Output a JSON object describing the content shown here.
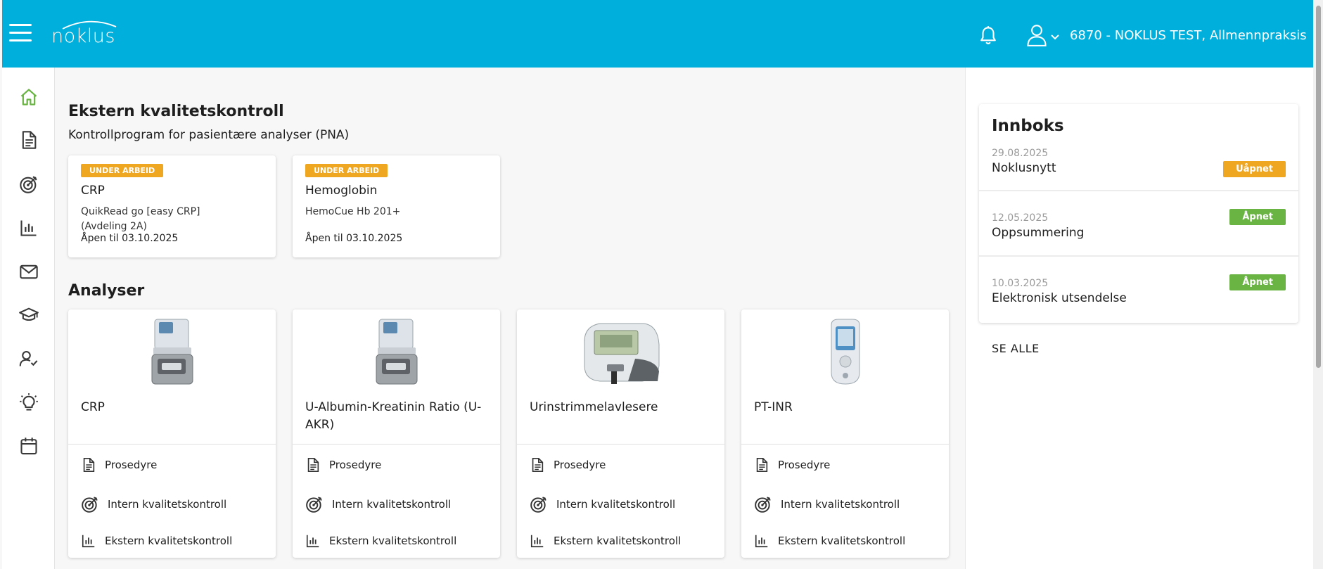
{
  "header": {
    "logo_text": "noklus",
    "user_label": "6870 - NOKLUS TEST, Allmennpraksis",
    "colors": {
      "brand": "#00afdc",
      "home_active": "#6ab444"
    }
  },
  "sidebar": {
    "items": [
      {
        "icon": "home-icon",
        "active": true
      },
      {
        "icon": "document-icon"
      },
      {
        "icon": "target-icon"
      },
      {
        "icon": "bar-chart-icon"
      },
      {
        "icon": "mail-icon"
      },
      {
        "icon": "graduation-cap-icon"
      },
      {
        "icon": "user-check-icon"
      },
      {
        "icon": "lightbulb-icon"
      },
      {
        "icon": "calendar-icon"
      }
    ]
  },
  "eqa": {
    "title": "Ekstern kvalitetskontroll",
    "subtitle": "Kontrollprogram for pasientære analyser (PNA)",
    "cards": [
      {
        "status": "UNDER ARBEID",
        "title": "CRP",
        "device": "QuikRead go [easy CRP] (Avdeling 2A)",
        "open_until": "Åpen til 03.10.2025"
      },
      {
        "status": "UNDER ARBEID",
        "title": "Hemoglobin",
        "device": "HemoCue Hb 201+",
        "open_until": "Åpen til 03.10.2025"
      }
    ]
  },
  "analyses": {
    "title": "Analyser",
    "link_labels": {
      "procedure": "Prosedyre",
      "internal": "Intern kvalitetskontroll",
      "external": "Ekstern kvalitetskontroll"
    },
    "cards": [
      {
        "title": "CRP",
        "image": "analyzer-device-image"
      },
      {
        "title": "U-Albumin-Kreatinin Ratio (U-AKR)",
        "image": "analyzer-device-image"
      },
      {
        "title": "Urinstrimmelavlesere",
        "image": "urine-strip-reader-image"
      },
      {
        "title": "PT-INR",
        "image": "inr-meter-image"
      }
    ]
  },
  "inbox": {
    "title": "Innboks",
    "items": [
      {
        "date": "29.08.2025",
        "subject": "Noklusnytt",
        "status": "Uåpnet",
        "status_color": "#efa620"
      },
      {
        "date": "12.05.2025",
        "subject": "Oppsummering",
        "status": "Åpnet",
        "status_color": "#6ab444"
      },
      {
        "date": "10.03.2025",
        "subject": "Elektronisk utsendelse",
        "status": "Åpnet",
        "status_color": "#6ab444"
      }
    ],
    "see_all": "SE ALLE"
  }
}
